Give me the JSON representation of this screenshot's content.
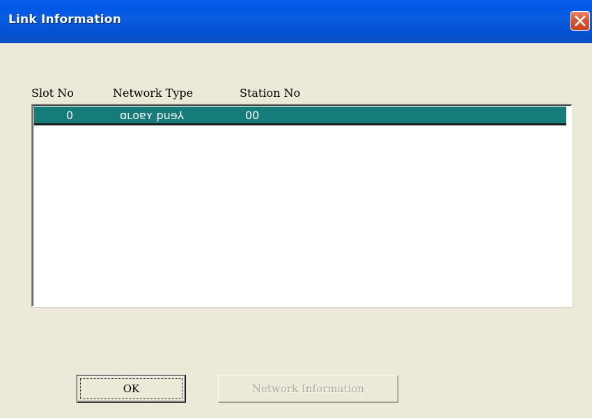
{
  "window": {
    "title": "Link Information",
    "close_icon": "close-icon"
  },
  "list": {
    "columns": [
      "Slot No",
      "Network Type",
      "Station No"
    ],
    "rows": [
      {
        "slot_no": "0",
        "network_type": "ɑʟoɐʏ puɘ⅄",
        "station_no": "00",
        "selected": true
      }
    ]
  },
  "buttons": {
    "ok_label": "OK",
    "network_info_label": "Network Information",
    "network_info_enabled": false
  },
  "colors": {
    "title_bar": "#0058E6",
    "close_button": "#D9562F",
    "selection": "#157C7A",
    "dialog_bg": "#ECE9D8"
  }
}
